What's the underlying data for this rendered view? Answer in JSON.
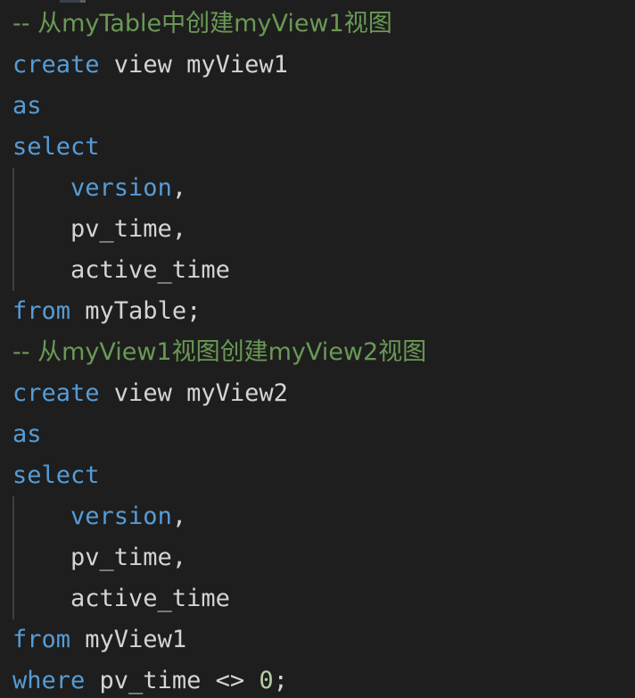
{
  "editor": {
    "background_color": "#1e1e1e",
    "default_text_color": "#d4d4d4",
    "indent_guide_color": "#404040",
    "language": "sql",
    "font_size_px": 27,
    "line_height_px": 46,
    "selection_sliver_color": "#3a4048",
    "colors": {
      "keyword": "#569cd6",
      "comment": "#6a9955",
      "identifier": "#d4d4d4",
      "number": "#b5cea8",
      "operator": "#d4d4d4",
      "punctuation": "#d4d4d4"
    },
    "lines": [
      {
        "indented": false,
        "tokens": [
          {
            "type": "comment",
            "text": "-- 从myTable中创建myView1视图"
          }
        ]
      },
      {
        "indented": false,
        "tokens": [
          {
            "type": "keyword",
            "text": "create"
          },
          {
            "type": "plain",
            "text": " view myView1"
          }
        ]
      },
      {
        "indented": false,
        "tokens": [
          {
            "type": "keyword",
            "text": "as"
          }
        ]
      },
      {
        "indented": false,
        "tokens": [
          {
            "type": "keyword",
            "text": "select"
          }
        ]
      },
      {
        "indented": true,
        "tokens": [
          {
            "type": "plain",
            "text": "    "
          },
          {
            "type": "keyword",
            "text": "version"
          },
          {
            "type": "punct",
            "text": ","
          }
        ]
      },
      {
        "indented": true,
        "tokens": [
          {
            "type": "plain",
            "text": "    pv_time"
          },
          {
            "type": "punct",
            "text": ","
          }
        ]
      },
      {
        "indented": true,
        "tokens": [
          {
            "type": "plain",
            "text": "    active_time"
          }
        ]
      },
      {
        "indented": false,
        "tokens": [
          {
            "type": "keyword",
            "text": "from"
          },
          {
            "type": "plain",
            "text": " myTable"
          },
          {
            "type": "punct",
            "text": ";"
          }
        ]
      },
      {
        "indented": false,
        "tokens": [
          {
            "type": "comment",
            "text": "-- 从myView1视图创建myView2视图"
          }
        ]
      },
      {
        "indented": false,
        "tokens": [
          {
            "type": "keyword",
            "text": "create"
          },
          {
            "type": "plain",
            "text": " view myView2"
          }
        ]
      },
      {
        "indented": false,
        "tokens": [
          {
            "type": "keyword",
            "text": "as"
          }
        ]
      },
      {
        "indented": false,
        "tokens": [
          {
            "type": "keyword",
            "text": "select"
          }
        ]
      },
      {
        "indented": true,
        "tokens": [
          {
            "type": "plain",
            "text": "    "
          },
          {
            "type": "keyword",
            "text": "version"
          },
          {
            "type": "punct",
            "text": ","
          }
        ]
      },
      {
        "indented": true,
        "tokens": [
          {
            "type": "plain",
            "text": "    pv_time"
          },
          {
            "type": "punct",
            "text": ","
          }
        ]
      },
      {
        "indented": true,
        "tokens": [
          {
            "type": "plain",
            "text": "    active_time"
          }
        ]
      },
      {
        "indented": false,
        "tokens": [
          {
            "type": "keyword",
            "text": "from"
          },
          {
            "type": "plain",
            "text": " myView1"
          }
        ]
      },
      {
        "indented": false,
        "tokens": [
          {
            "type": "keyword",
            "text": "where"
          },
          {
            "type": "plain",
            "text": " pv_time "
          },
          {
            "type": "operator",
            "text": "<>"
          },
          {
            "type": "plain",
            "text": " "
          },
          {
            "type": "number",
            "text": "0"
          },
          {
            "type": "punct",
            "text": ";"
          }
        ]
      }
    ]
  }
}
